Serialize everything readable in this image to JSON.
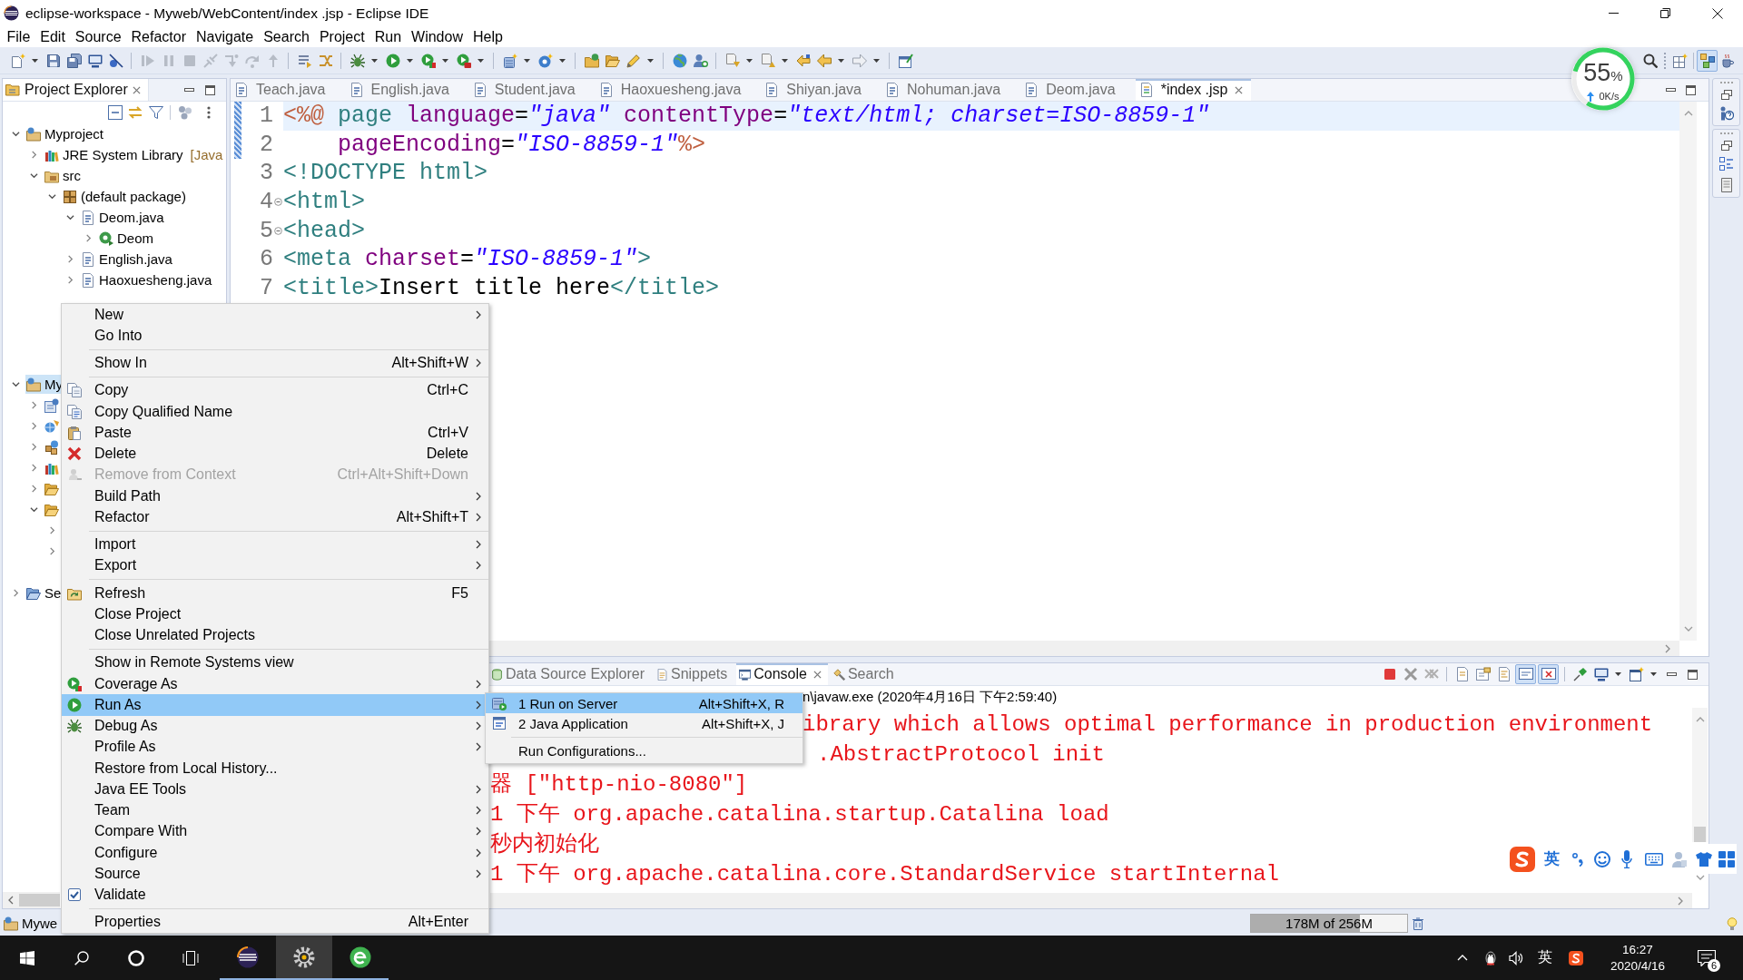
{
  "window": {
    "title": "eclipse-workspace - Myweb/WebContent/index .jsp - Eclipse IDE"
  },
  "menu_bar": [
    "File",
    "Edit",
    "Source",
    "Refactor",
    "Navigate",
    "Search",
    "Project",
    "Run",
    "Window",
    "Help"
  ],
  "toolbar": {
    "debug_controls_enabled": false,
    "perspectives": [
      {
        "selected": true
      },
      {
        "selected": false
      }
    ]
  },
  "resource_monitor": {
    "percent": "55",
    "unit": "%",
    "speed": "0K/s"
  },
  "project_explorer": {
    "title": "Project Explorer",
    "tree": [
      {
        "label": "Myproject",
        "kind": "project",
        "expanded": true,
        "selected": false,
        "children": [
          {
            "label": "JRE System Library",
            "decoration": "[Java",
            "kind": "library",
            "expanded": false,
            "selected": false
          },
          {
            "label": "src",
            "kind": "source_folder",
            "expanded": true,
            "selected": false,
            "children": [
              {
                "label": "(default package)",
                "kind": "package",
                "expanded": true,
                "selected": false,
                "children": [
                  {
                    "label": "Deom.java",
                    "kind": "java_file",
                    "expanded": true,
                    "selected": false,
                    "children": [
                      {
                        "label": "Deom",
                        "kind": "class",
                        "expanded": false,
                        "selected": false
                      }
                    ]
                  },
                  {
                    "label": "English.java",
                    "kind": "java_file",
                    "expanded": false,
                    "selected": false
                  },
                  {
                    "label": "Haoxuesheng.java",
                    "kind": "java_file",
                    "expanded": false,
                    "selected": false
                  }
                ]
              }
            ]
          }
        ]
      },
      {
        "label": "My",
        "kind": "project",
        "expanded": true,
        "selected": true,
        "children": [
          {
            "kind": "descriptor",
            "expanded": false,
            "selected": false
          },
          {
            "kind": "web_module",
            "expanded": false,
            "selected": false
          },
          {
            "kind": "java_resources",
            "expanded": false,
            "selected": false
          },
          {
            "kind": "library",
            "expanded": false,
            "selected": false
          },
          {
            "kind": "open_folder",
            "expanded": false,
            "selected": false
          },
          {
            "kind": "open_folder",
            "expanded": true,
            "selected": false,
            "children": [
              {
                "expanded": false
              },
              {
                "expanded": false
              }
            ]
          }
        ]
      },
      {
        "label": "Se",
        "kind": "server_folder",
        "expanded": false,
        "selected": false
      }
    ]
  },
  "editor": {
    "tabs": [
      {
        "label": "Teach.java",
        "kind": "java",
        "selected": false
      },
      {
        "label": "English.java",
        "kind": "java",
        "selected": false
      },
      {
        "label": "Student.java",
        "kind": "java",
        "selected": false
      },
      {
        "label": "Haoxuesheng.java",
        "kind": "java",
        "selected": false
      },
      {
        "label": "Shiyan.java",
        "kind": "java",
        "selected": false
      },
      {
        "label": "Nohuman.java",
        "kind": "java",
        "selected": false
      },
      {
        "label": "Deom.java",
        "kind": "java",
        "selected": false
      },
      {
        "label": "*index .jsp",
        "kind": "jsp",
        "selected": true
      }
    ],
    "lines": [
      {
        "number": "1",
        "changed": true,
        "fold": false,
        "current": true,
        "tokens": [
          {
            "text": "<%@",
            "kind": "directive"
          },
          {
            "text": " page",
            "kind": "tag"
          },
          {
            "text": " language",
            "kind": "attribute"
          },
          {
            "text": "=",
            "kind": "text"
          },
          {
            "text": "\"java\"",
            "kind": "value"
          },
          {
            "text": " contentType",
            "kind": "attribute"
          },
          {
            "text": "=",
            "kind": "text"
          },
          {
            "text": "\"text/html; charset=ISO-8859-1\"",
            "kind": "value"
          }
        ]
      },
      {
        "number": "2",
        "changed": true,
        "fold": false,
        "current": false,
        "tokens": [
          {
            "text": "    pageEncoding",
            "kind": "attribute"
          },
          {
            "text": "=",
            "kind": "text"
          },
          {
            "text": "\"ISO-8859-1\"",
            "kind": "value"
          },
          {
            "text": "%>",
            "kind": "directive"
          }
        ]
      },
      {
        "number": "3",
        "changed": false,
        "fold": false,
        "current": false,
        "tokens": [
          {
            "text": "<!DOCTYPE html>",
            "kind": "tag"
          }
        ]
      },
      {
        "number": "4",
        "changed": false,
        "fold": true,
        "current": false,
        "tokens": [
          {
            "text": "<html>",
            "kind": "tag"
          }
        ]
      },
      {
        "number": "5",
        "changed": false,
        "fold": true,
        "current": false,
        "tokens": [
          {
            "text": "<head>",
            "kind": "tag"
          }
        ]
      },
      {
        "number": "6",
        "changed": false,
        "fold": false,
        "current": false,
        "tokens": [
          {
            "text": "<meta",
            "kind": "tag"
          },
          {
            "text": " charset",
            "kind": "attribute"
          },
          {
            "text": "=",
            "kind": "text"
          },
          {
            "text": "\"ISO-8859-1\"",
            "kind": "value"
          },
          {
            "text": ">",
            "kind": "tag"
          }
        ]
      },
      {
        "number": "7",
        "changed": false,
        "fold": false,
        "current": false,
        "tokens": [
          {
            "text": "<title>",
            "kind": "tag"
          },
          {
            "text": "Insert title here",
            "kind": "text"
          },
          {
            "text": "</title>",
            "kind": "tag"
          }
        ]
      }
    ]
  },
  "bottom_panel": {
    "tabs": [
      {
        "label": "Data Source Explorer",
        "selected": false
      },
      {
        "label": "Snippets",
        "selected": false
      },
      {
        "label": "Console",
        "selected": true
      },
      {
        "label": "Search",
        "selected": false
      }
    ],
    "console_toggles": [
      {
        "on": true
      },
      {
        "on": true
      }
    ],
    "console_header": "n\\javaw.exe (2020年4月16日 下午2:59:40)",
    "console_lines": [
      "ibrary which allows optimal performance in production environment",
      ".AbstractProtocol init",
      "器 [\"http-nio-8080\"]",
      "1 下午 org.apache.catalina.startup.Catalina load",
      "秒内初始化",
      "1 下午 org.apache.catalina.core.StandardService startInternal"
    ]
  },
  "context_menu": {
    "items": [
      {
        "kind": "item",
        "label": "New",
        "arrow": true,
        "disabled": false,
        "selected": false
      },
      {
        "kind": "item",
        "label": "Go Into",
        "arrow": false,
        "disabled": false,
        "selected": false
      },
      {
        "kind": "separator"
      },
      {
        "kind": "item",
        "label": "Show In",
        "shortcut": "Alt+Shift+W",
        "arrow": true,
        "disabled": false,
        "selected": false
      },
      {
        "kind": "separator"
      },
      {
        "kind": "item",
        "label": "Copy",
        "shortcut": "Ctrl+C",
        "arrow": false,
        "disabled": false,
        "selected": false
      },
      {
        "kind": "item",
        "label": "Copy Qualified Name",
        "arrow": false,
        "disabled": false,
        "selected": false
      },
      {
        "kind": "item",
        "label": "Paste",
        "shortcut": "Ctrl+V",
        "arrow": false,
        "disabled": false,
        "selected": false
      },
      {
        "kind": "item",
        "label": "Delete",
        "shortcut": "Delete",
        "arrow": false,
        "disabled": false,
        "selected": false
      },
      {
        "kind": "item",
        "label": "Remove from Context",
        "shortcut": "Ctrl+Alt+Shift+Down",
        "arrow": false,
        "disabled": true,
        "selected": false
      },
      {
        "kind": "item",
        "label": "Build Path",
        "arrow": true,
        "disabled": false,
        "selected": false
      },
      {
        "kind": "item",
        "label": "Refactor",
        "shortcut": "Alt+Shift+T",
        "arrow": true,
        "disabled": false,
        "selected": false
      },
      {
        "kind": "separator"
      },
      {
        "kind": "item",
        "label": "Import",
        "arrow": true,
        "disabled": false,
        "selected": false
      },
      {
        "kind": "item",
        "label": "Export",
        "arrow": true,
        "disabled": false,
        "selected": false
      },
      {
        "kind": "separator"
      },
      {
        "kind": "item",
        "label": "Refresh",
        "shortcut": "F5",
        "arrow": false,
        "disabled": false,
        "selected": false
      },
      {
        "kind": "item",
        "label": "Close Project",
        "arrow": false,
        "disabled": false,
        "selected": false
      },
      {
        "kind": "item",
        "label": "Close Unrelated Projects",
        "arrow": false,
        "disabled": false,
        "selected": false
      },
      {
        "kind": "separator"
      },
      {
        "kind": "item",
        "label": "Show in Remote Systems view",
        "arrow": false,
        "disabled": false,
        "selected": false
      },
      {
        "kind": "item",
        "label": "Coverage As",
        "arrow": true,
        "disabled": false,
        "selected": false
      },
      {
        "kind": "item",
        "label": "Run As",
        "arrow": true,
        "disabled": false,
        "selected": true,
        "submenu": {
          "items": [
            {
              "kind": "item",
              "label": "1 Run on Server",
              "shortcut": "Alt+Shift+X, R",
              "disabled": false,
              "selected": true
            },
            {
              "kind": "item",
              "label": "2 Java Application",
              "shortcut": "Alt+Shift+X, J",
              "disabled": false,
              "selected": false
            },
            {
              "kind": "separator"
            },
            {
              "kind": "item",
              "label": "Run Configurations...",
              "disabled": false,
              "selected": false
            }
          ]
        }
      },
      {
        "kind": "item",
        "label": "Debug As",
        "arrow": true,
        "disabled": false,
        "selected": false
      },
      {
        "kind": "item",
        "label": "Profile As",
        "arrow": true,
        "disabled": false,
        "selected": false
      },
      {
        "kind": "item",
        "label": "Restore from Local History...",
        "arrow": false,
        "disabled": false,
        "selected": false
      },
      {
        "kind": "item",
        "label": "Java EE Tools",
        "arrow": true,
        "disabled": false,
        "selected": false
      },
      {
        "kind": "item",
        "label": "Team",
        "arrow": true,
        "disabled": false,
        "selected": false
      },
      {
        "kind": "item",
        "label": "Compare With",
        "arrow": true,
        "disabled": false,
        "selected": false
      },
      {
        "kind": "item",
        "label": "Configure",
        "arrow": true,
        "disabled": false,
        "selected": false
      },
      {
        "kind": "item",
        "label": "Source",
        "arrow": true,
        "disabled": false,
        "selected": false
      },
      {
        "kind": "item",
        "label": "Validate",
        "arrow": false,
        "disabled": false,
        "selected": false
      },
      {
        "kind": "separator"
      },
      {
        "kind": "item",
        "label": "Properties",
        "shortcut": "Alt+Enter",
        "arrow": false,
        "disabled": false,
        "selected": false
      }
    ]
  },
  "input_method_bar": {
    "mode": "英"
  },
  "status_bar": {
    "selection": "Mywe",
    "heap": {
      "text": "178M of 256M",
      "level": 0.7
    }
  },
  "taskbar": {
    "apps": [
      {
        "running": true,
        "active": false
      },
      {
        "running": true,
        "active": true
      },
      {
        "running": true,
        "active": false
      }
    ],
    "language": "英",
    "time": "16:27",
    "date": "2020/4/16",
    "notification_count": "6"
  }
}
